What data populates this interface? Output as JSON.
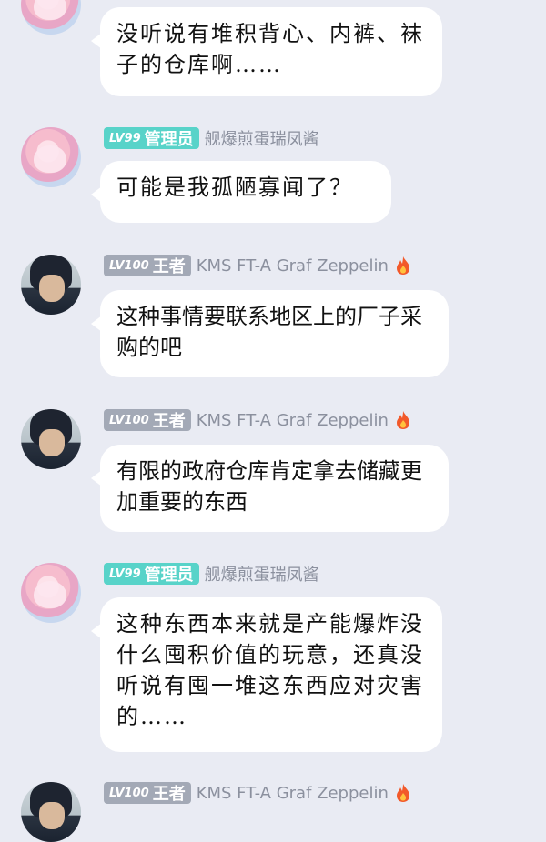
{
  "messages": [
    {
      "avatar": "pink-hair-girl-avatar",
      "badge": null,
      "text": "没听说有堆积背心、内裤、袜子的仓库啊……"
    },
    {
      "avatar": "pink-hair-girl-avatar",
      "badge": {
        "level": "LV99",
        "role": "管理员",
        "color": "#58d3c9"
      },
      "username": "舰爆煎蛋瑞凤酱",
      "text": "可能是我孤陋寡闻了？"
    },
    {
      "avatar": "dark-hair-man-avatar",
      "badge": {
        "level": "LV100",
        "role": "王者",
        "color": "#a3a9b6"
      },
      "username": "KMS FT-A Graf Zeppelin",
      "flame": true,
      "text": "这种事情要联系地区上的厂子采购的吧"
    },
    {
      "avatar": "dark-hair-man-avatar",
      "badge": {
        "level": "LV100",
        "role": "王者",
        "color": "#a3a9b6"
      },
      "username": "KMS FT-A Graf Zeppelin",
      "flame": true,
      "text": "有限的政府仓库肯定拿去储藏更加重要的东西"
    },
    {
      "avatar": "pink-hair-girl-avatar",
      "badge": {
        "level": "LV99",
        "role": "管理员",
        "color": "#58d3c9"
      },
      "username": "舰爆煎蛋瑞凤酱",
      "text": "这种东西本来就是产能爆炸没什么囤积价值的玩意，还真没听说有囤一堆这东西应对灾害的……"
    },
    {
      "avatar": "dark-hair-man-avatar",
      "badge": {
        "level": "LV100",
        "role": "王者",
        "color": "#a3a9b6"
      },
      "username": "KMS FT-A Graf Zeppelin",
      "flame": true,
      "text": ""
    }
  ]
}
